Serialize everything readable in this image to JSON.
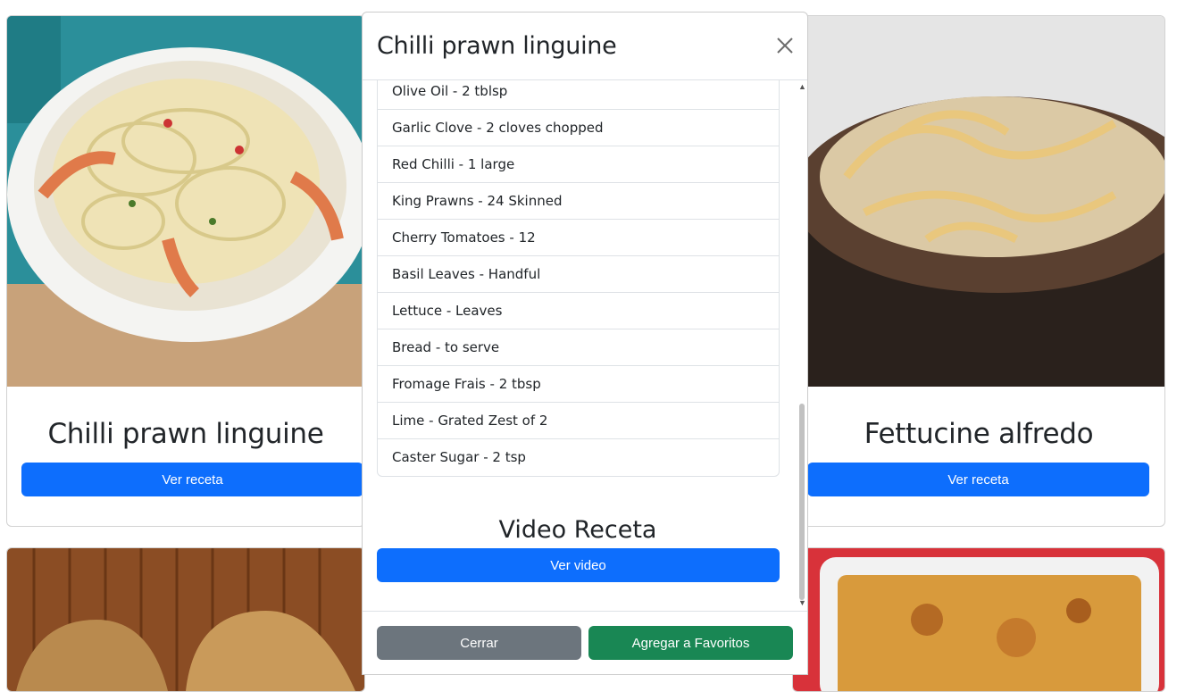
{
  "cards": [
    {
      "title": "Chilli prawn linguine",
      "button": "Ver receta"
    },
    {
      "title": "Fettucine alfredo",
      "button": "Ver receta"
    }
  ],
  "modal": {
    "title": "Chilli prawn linguine",
    "ingredients": [
      "Olive Oil - 2 tblsp",
      "Garlic Clove - 2 cloves chopped",
      "Red Chilli - 1 large",
      "King Prawns - 24 Skinned",
      "Cherry Tomatoes - 12",
      "Basil Leaves - Handful",
      "Lettuce - Leaves",
      "Bread - to serve",
      "Fromage Frais - 2 tbsp",
      "Lime - Grated Zest of 2",
      "Caster Sugar - 2 tsp"
    ],
    "video_title": "Video Receta",
    "video_button": "Ver video",
    "close_button": "Cerrar",
    "favorite_button": "Agregar a Favoritos"
  },
  "colors": {
    "primary": "#0d6efd",
    "secondary": "#6c757d",
    "success": "#198754"
  }
}
